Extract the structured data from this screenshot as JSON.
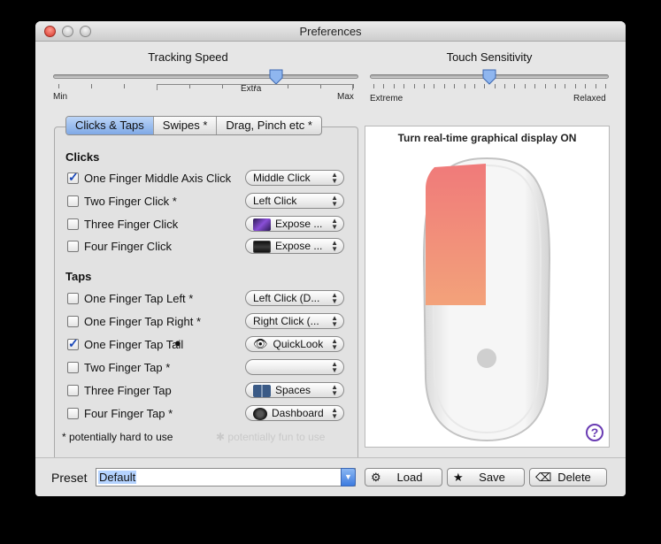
{
  "window": {
    "title": "Preferences"
  },
  "tracking": {
    "label": "Tracking Speed",
    "min_label": "Min",
    "max_label": "Max",
    "extra_label": "Extra",
    "level": 0.73
  },
  "touch": {
    "label": "Touch Sensitivity",
    "left_label": "Extreme",
    "right_label": "Relaxed",
    "level": 0.5
  },
  "tabs": [
    {
      "label": "Clicks & Taps",
      "active": true
    },
    {
      "label": "Swipes *",
      "active": false
    },
    {
      "label": "Drag, Pinch etc *",
      "active": false
    }
  ],
  "clicks": {
    "title": "Clicks",
    "rows": [
      {
        "label": "One Finger Middle Axis Click",
        "checked": true,
        "popup": "Middle Click",
        "icon": ""
      },
      {
        "label": "Two Finger Click *",
        "checked": false,
        "popup": "Left Click",
        "icon": ""
      },
      {
        "label": "Three Finger Click",
        "checked": false,
        "popup": "Expose ...",
        "icon": "expose-icon"
      },
      {
        "label": "Four Finger Click",
        "checked": false,
        "popup": "Expose ...",
        "icon": "expose-desktop-icon"
      }
    ]
  },
  "taps": {
    "title": "Taps",
    "rows": [
      {
        "label": "One Finger Tap Left *",
        "checked": false,
        "popup": "Left Click (D...",
        "icon": ""
      },
      {
        "label": "One Finger Tap Right *",
        "checked": false,
        "popup": "Right Click (...",
        "icon": ""
      },
      {
        "label": "One Finger Tap  Tail",
        "checked": true,
        "popup": "QuickLook",
        "icon": "eye-icon"
      },
      {
        "label": "Two Finger Tap *",
        "checked": false,
        "popup": "",
        "icon": ""
      },
      {
        "label": "Three Finger Tap",
        "checked": false,
        "popup": "Spaces",
        "icon": "spaces-icon"
      },
      {
        "label": "Four Finger Tap *",
        "checked": false,
        "popup": "Dashboard",
        "icon": "dashboard-icon"
      }
    ]
  },
  "footnotes": {
    "hard": "* potentially hard to use",
    "fun": "potentially fun to use"
  },
  "preview": {
    "title": "Turn real-time graphical display ON",
    "help": "?"
  },
  "bottom": {
    "preset_label": "Preset",
    "preset_value": "Default",
    "load_label": "Load",
    "save_label": "Save",
    "delete_label": "Delete"
  },
  "colors": {
    "accent": "#7fa9e6",
    "touch_gradient_top": "#f07a7a",
    "touch_gradient_bottom": "#f3a27a",
    "help": "#6a3cb3"
  }
}
